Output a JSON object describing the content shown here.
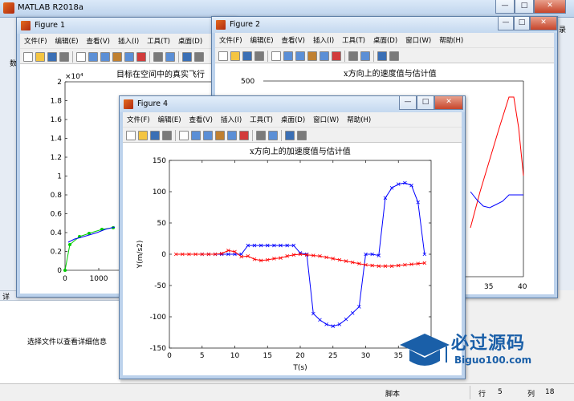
{
  "main": {
    "title": "MATLAB R2018a",
    "detail_message": "选择文件以查看详细信息",
    "status": {
      "script": "脚本",
      "row_label": "行",
      "row_value": "5",
      "col_label": "列",
      "col_value": "18"
    },
    "min_symbol": "—",
    "max_symbol": "□",
    "close_symbol": "✕",
    "left_strip_text": "数",
    "right_strip_text": "录",
    "detail_tab": "详"
  },
  "menus": {
    "file": "文件(F)",
    "edit": "编辑(E)",
    "view": "查看(V)",
    "insert": "插入(I)",
    "tools": "工具(T)",
    "desktop": "桌面(D)",
    "window": "窗口(W)",
    "help": "帮助(H)"
  },
  "figure1": {
    "title": "Figure 1",
    "plot_title": "目标在空间中的真实飞行",
    "exponent": "×10⁴",
    "y_ticks": [
      "0",
      "0.2",
      "0.4",
      "0.6",
      "0.8",
      "1",
      "1.2",
      "1.4",
      "1.6",
      "1.8",
      "2"
    ],
    "x_ticks": [
      "0",
      "1000"
    ]
  },
  "figure2": {
    "title": "Figure 2",
    "plot_title": "x方向上的速度值与估计值",
    "y_ticks": [
      "500"
    ],
    "x_ticks": [
      "35",
      "40"
    ]
  },
  "figure4": {
    "title": "Figure 4",
    "window_controls": {
      "min": "—",
      "max": "□",
      "close": "✕"
    }
  },
  "chart_data": {
    "type": "line",
    "title": "x方向上的加速度值与估计值",
    "xlabel": "T(s)",
    "ylabel": "Y(m/s2)",
    "xlim": [
      0,
      40
    ],
    "ylim": [
      -150,
      150
    ],
    "x_ticks": [
      0,
      5,
      10,
      15,
      20,
      25,
      30,
      35
    ],
    "y_ticks": [
      -150,
      -100,
      -50,
      0,
      50,
      100,
      150
    ],
    "grid": false,
    "series": [
      {
        "color": "#0000ff",
        "marker": "x",
        "x": [
          5,
          6,
          7,
          8,
          9,
          10,
          11,
          12,
          13,
          14,
          15,
          16,
          17,
          18,
          19,
          20,
          21,
          22,
          23,
          24,
          25,
          26,
          27,
          28,
          29,
          30,
          31,
          32,
          33,
          34,
          35,
          36,
          37,
          38,
          39
        ],
        "y": [
          0,
          0,
          0,
          0,
          0,
          0,
          0,
          14,
          14,
          14,
          14,
          14,
          14,
          14,
          14,
          2,
          0,
          -95,
          -105,
          -112,
          -115,
          -112,
          -104,
          -94,
          -84,
          0,
          0,
          -2,
          90,
          106,
          112,
          114,
          110,
          83,
          0
        ]
      },
      {
        "color": "#ff0000",
        "marker": "x",
        "x": [
          1,
          2,
          3,
          4,
          5,
          6,
          7,
          8,
          9,
          10,
          11,
          12,
          13,
          14,
          15,
          16,
          17,
          18,
          19,
          20,
          21,
          22,
          23,
          24,
          25,
          26,
          27,
          28,
          29,
          30,
          31,
          32,
          33,
          34,
          35,
          36,
          37,
          38,
          39
        ],
        "y": [
          0,
          0,
          0,
          0,
          0,
          0,
          0,
          1,
          6,
          4,
          -4,
          -3,
          -8,
          -10,
          -9,
          -7,
          -6,
          -3,
          -1,
          0,
          -1,
          -2,
          -3,
          -5,
          -7,
          -9,
          -11,
          -13,
          -15,
          -17,
          -18,
          -19,
          -19,
          -19,
          -18,
          -17,
          -16,
          -15,
          -14
        ]
      }
    ]
  },
  "colors": {
    "blue_series": "#0000ff",
    "red_series": "#ff0000",
    "green_series": "#00cc00",
    "titlebar": "#c4d8ef"
  }
}
